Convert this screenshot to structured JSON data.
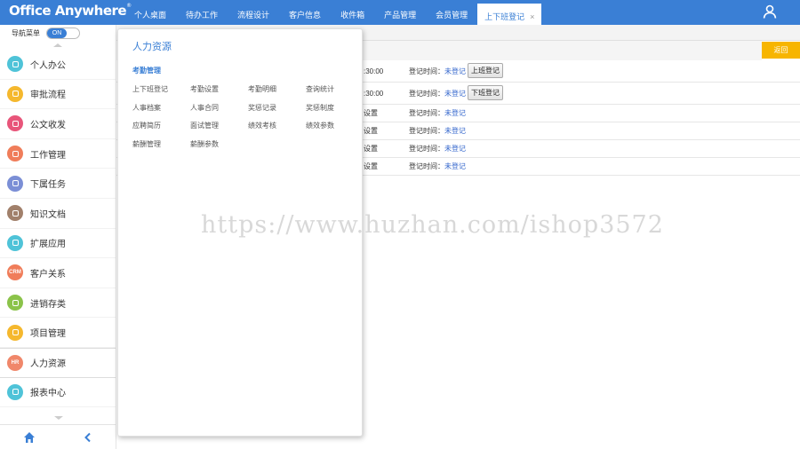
{
  "app": {
    "logo": "Office Anywhere",
    "logo_mark": "®"
  },
  "top_nav": {
    "items": [
      {
        "label": "个人桌面"
      },
      {
        "label": "待办工作"
      },
      {
        "label": "流程设计"
      },
      {
        "label": "客户信息"
      },
      {
        "label": "收件箱"
      },
      {
        "label": "产品管理"
      },
      {
        "label": "会员管理"
      }
    ],
    "active_tab": {
      "label": "上下班登记",
      "close": "×"
    },
    "user_icon": "user-icon"
  },
  "sidebar": {
    "toggle_label": "导航菜单",
    "toggle_state": "ON",
    "items": [
      {
        "label": "个人办公",
        "icon": "person-icon",
        "color": "#4fc3d8"
      },
      {
        "label": "审批流程",
        "icon": "approval-icon",
        "color": "#f5b82e"
      },
      {
        "label": "公文收发",
        "icon": "document-icon",
        "color": "#e8557a"
      },
      {
        "label": "工作管理",
        "icon": "work-icon",
        "color": "#f07d5a"
      },
      {
        "label": "下属任务",
        "icon": "team-icon",
        "color": "#7b8fd6"
      },
      {
        "label": "知识文档",
        "icon": "book-icon",
        "color": "#a1806b"
      },
      {
        "label": "扩展应用",
        "icon": "extension-icon",
        "color": "#4fc3d8"
      },
      {
        "label": "客户关系",
        "icon": "crm-icon",
        "color": "#f07d5a",
        "badge": "CRM"
      },
      {
        "label": "进销存类",
        "icon": "cart-icon",
        "color": "#8bc34a"
      },
      {
        "label": "项目管理",
        "icon": "project-icon",
        "color": "#f5b82e"
      },
      {
        "label": "人力资源",
        "icon": "hr-icon",
        "color": "#f0876a",
        "badge": "HR",
        "active": true
      },
      {
        "label": "报表中心",
        "icon": "report-icon",
        "color": "#4fc3d8"
      }
    ],
    "bottom": {
      "home_icon": "home-icon",
      "collapse_icon": "chevron-left-icon"
    }
  },
  "content": {
    "return_label": "返回",
    "rows": [
      {
        "time": ":30:00",
        "label": "登记时间：",
        "status": "未登记",
        "button": "上班登记"
      },
      {
        "time": ":30:00",
        "label": "登记时间：",
        "status": "未登记",
        "button": "下班登记"
      },
      {
        "time": "设置",
        "label": "登记时间：",
        "status": "未登记"
      },
      {
        "time": "设置",
        "label": "登记时间：",
        "status": "未登记"
      },
      {
        "time": "设置",
        "label": "登记时间：",
        "status": "未登记"
      },
      {
        "time": "设置",
        "label": "登记时间：",
        "status": "未登记"
      }
    ]
  },
  "dropdown": {
    "title": "人力资源",
    "section": "考勤管理",
    "links": [
      "上下班登记",
      "考勤设置",
      "考勤明细",
      "查询统计",
      "人事档案",
      "人事合同",
      "奖惩记录",
      "奖惩制度",
      "应聘简历",
      "面试管理",
      "绩效考核",
      "绩效参数",
      "薪酬管理",
      "薪酬参数"
    ]
  },
  "watermark": "https://www.huzhan.com/ishop3572"
}
